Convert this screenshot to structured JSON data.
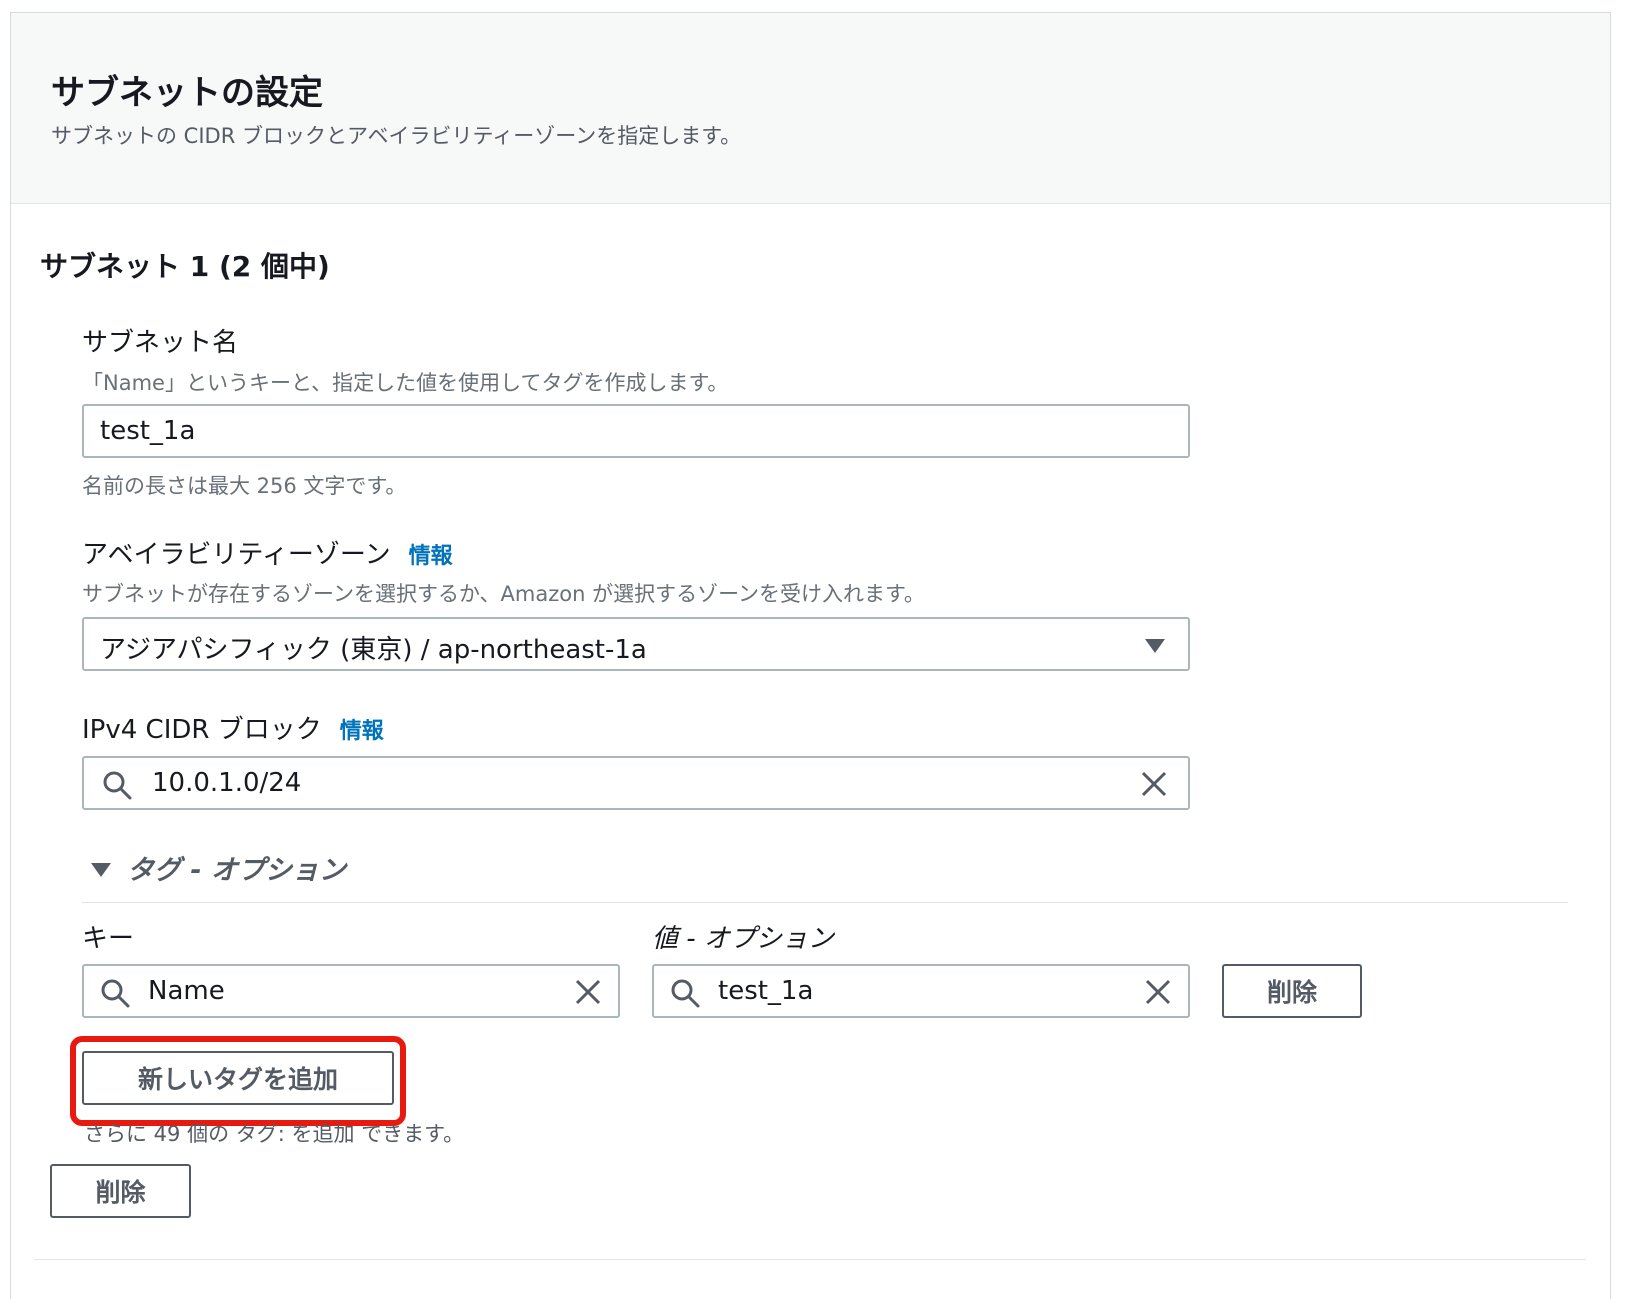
{
  "header": {
    "title": "サブネットの設定",
    "description": "サブネットの CIDR ブロックとアベイラビリティーゾーンを指定します。"
  },
  "subnet": {
    "title": "サブネット 1 (2 個中)",
    "name_label": "サブネット名",
    "name_description": "「Name」というキーと、指定した値を使用してタグを作成します。",
    "name_value": "test_1a",
    "name_constraint": "名前の長さは最大 256 文字です。",
    "az_label": "アベイラビリティーゾーン",
    "az_info": "情報",
    "az_description": "サブネットが存在するゾーンを選択するか、Amazon が選択するゾーンを受け入れます。",
    "az_value": "アジアパシフィック (東京) / ap-northeast-1a",
    "cidr_label": "IPv4 CIDR ブロック",
    "cidr_info": "情報",
    "cidr_value": "10.0.1.0/24"
  },
  "tags": {
    "section_label": "タグ - オプション",
    "key_label": "キー",
    "value_label": "値 - オプション",
    "rows": [
      {
        "key": "Name",
        "value": "test_1a",
        "remove_label": "削除"
      }
    ],
    "add_button": "新しいタグを追加",
    "remaining": "さらに 49 個の タグ: を追加 できます。"
  },
  "remove_subnet_button": "削除",
  "colors": {
    "link": "#0073bb",
    "highlight": "#e8190f",
    "border": "#aab7b8"
  },
  "icons": [
    "search-icon",
    "clear-icon",
    "caret-down-icon"
  ]
}
